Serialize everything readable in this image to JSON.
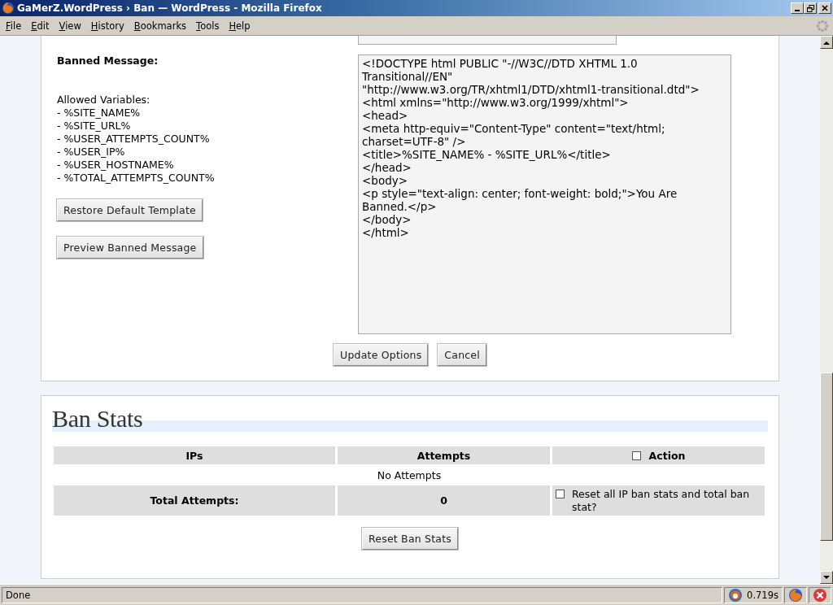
{
  "window": {
    "title": "GaMerZ.WordPress › Ban — WordPress - Mozilla Firefox"
  },
  "menu": [
    "File",
    "Edit",
    "View",
    "History",
    "Bookmarks",
    "Tools",
    "Help"
  ],
  "options": {
    "banned_message_label": "Banned Message:",
    "variables_title": "Allowed Variables:",
    "variables": [
      "- %SITE_NAME%",
      "- %SITE_URL%",
      "- %USER_ATTEMPTS_COUNT%",
      "- %USER_IP%",
      "- %USER_HOSTNAME%",
      "- %TOTAL_ATTEMPTS_COUNT%"
    ],
    "side_buttons": [
      "Restore Default Template",
      "Preview Banned Message"
    ],
    "template": "<!DOCTYPE html PUBLIC \"-//W3C//DTD XHTML 1.0 Transitional//EN\"\n\"http://www.w3.org/TR/xhtml1/DTD/xhtml1-transitional.dtd\">\n<html xmlns=\"http://www.w3.org/1999/xhtml\">\n<head>\n<meta http-equiv=\"Content-Type\" content=\"text/html;\ncharset=UTF-8\" />\n<title>%SITE_NAME% - %SITE_URL%</title>\n</head>\n<body>\n<p style=\"text-align: center; font-weight: bold;\">You Are\nBanned.</p>\n</body>\n</html>",
    "buttons": [
      "Update Options",
      "Cancel"
    ]
  },
  "ban_stats": {
    "title": "Ban Stats",
    "columns": [
      {
        "label": "IPs"
      },
      {
        "label": "Attempts"
      },
      {
        "label": "Action",
        "checked": false
      }
    ],
    "empty_message": "No Attempts",
    "total_label": "Total Attempts:",
    "total_value": "0",
    "reset_option": {
      "label": "Reset all IP ban stats and total ban stat?",
      "checked": false
    },
    "button": "Reset Ban Stats"
  },
  "status_bar": {
    "text": "Done",
    "timing": "0.719s"
  }
}
